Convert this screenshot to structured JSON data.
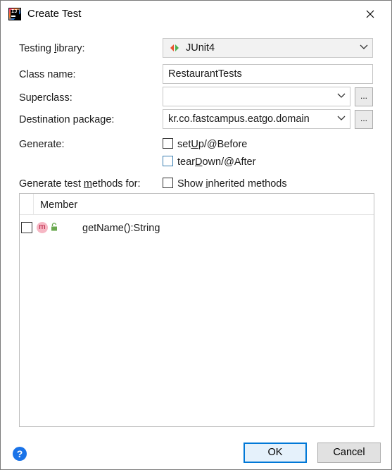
{
  "window": {
    "title": "Create Test"
  },
  "form": {
    "testing_library": {
      "label_pre": "Testing ",
      "label_mnemonic": "l",
      "label_post": "ibrary:",
      "value": "JUnit4"
    },
    "class_name": {
      "label": "Class name:",
      "value": "RestaurantTests"
    },
    "superclass": {
      "label": "Superclass:",
      "value": "",
      "browse_label": "..."
    },
    "destination_package": {
      "label": "Destination package:",
      "value": "kr.co.fastcampus.eatgo.domain",
      "browse_label": "..."
    },
    "generate": {
      "label": "Generate:",
      "setup": {
        "pre": "set",
        "mnemonic": "U",
        "post": "p/@Before",
        "checked": false
      },
      "teardown": {
        "pre": "tear",
        "mnemonic": "D",
        "post": "own/@After",
        "checked": false
      }
    },
    "methods_for": {
      "label_pre": "Generate test ",
      "label_mnemonic": "m",
      "label_post": "ethods for:",
      "show_inherited": {
        "pre": "Show ",
        "mnemonic": "i",
        "post": "nherited methods",
        "checked": false
      }
    }
  },
  "table": {
    "header": "Member",
    "rows": [
      {
        "icon": "m",
        "method": "getName():String",
        "checked": false
      }
    ]
  },
  "buttons": {
    "ok": "OK",
    "cancel": "Cancel",
    "help": "?"
  },
  "colors": {
    "accent": "#0078d7",
    "help": "#1a73e8",
    "method_icon": "#f6b7c4"
  }
}
